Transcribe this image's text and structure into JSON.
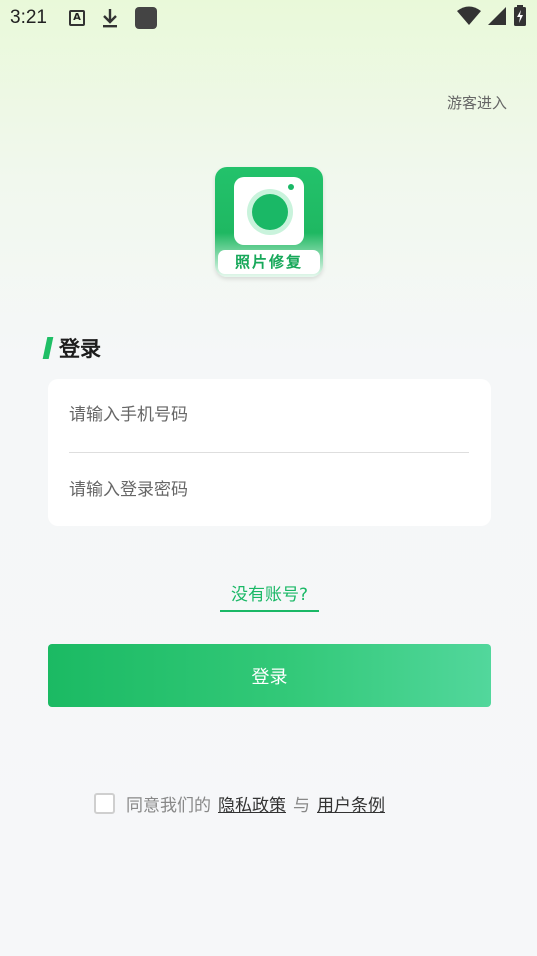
{
  "status_bar": {
    "time": "3:21",
    "left_icons": [
      "text-a-icon",
      "download-icon",
      "app-square-icon"
    ],
    "right_icons": [
      "wifi-icon",
      "signal-icon",
      "battery-charging-icon"
    ]
  },
  "header": {
    "guest_link": "游客进入"
  },
  "logo": {
    "label": "照片修复"
  },
  "login_section": {
    "title": "登录",
    "phone_placeholder": "请输入手机号码",
    "password_placeholder": "请输入登录密码",
    "no_account_link": "没有账号?",
    "login_button": "登录"
  },
  "agreement": {
    "checked": false,
    "prefix": "同意我们的",
    "privacy_link": "隐私政策",
    "separator": "与",
    "terms_link": "用户条例"
  },
  "colors": {
    "accent": "#1ab866",
    "button_start": "#1bba63",
    "button_end": "#52d79c"
  }
}
